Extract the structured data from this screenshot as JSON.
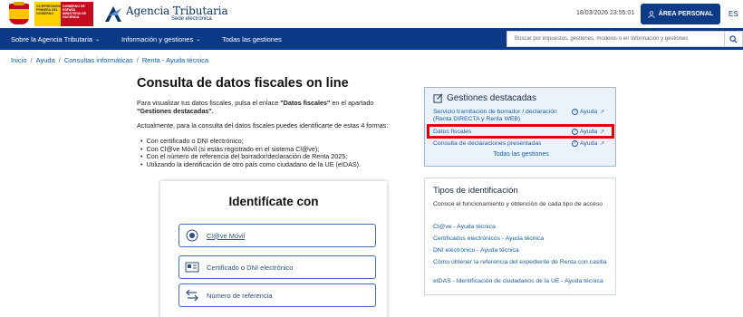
{
  "header": {
    "gov_yellow_text": "VICEPRESIDENCIA PRIMERA DEL GOBIERNO",
    "gov_red_text": "GOBIERNO DE ESPAÑA MINISTERIO DE HACIENDA",
    "agency_title": "Agencia Tributaria",
    "agency_sub": "Sede electrónica",
    "datetime": "18/03/2026 23:55:01",
    "area_button": "ÁREA PERSONAL",
    "lang": "ES"
  },
  "nav": {
    "items": [
      {
        "label": "Sobre la Agencia Tributaria"
      },
      {
        "label": "Información y gestiones"
      },
      {
        "label": "Todas las gestiones"
      }
    ],
    "search_placeholder": "Buscar por impuestos, gestiones, modelos o en Información y gestiones"
  },
  "breadcrumb": [
    "Inicio",
    "Ayuda",
    "Consultas informáticas",
    "Renta - Ayuda técnica"
  ],
  "main": {
    "title": "Consulta de datos fiscales on line",
    "p1_a": "Para visualizar tus datos fiscales, pulsa el enlace ",
    "p1_b": "\"Datos fiscales\"",
    "p1_c": " en el apartado ",
    "p1_d": "\"Gestiones destacadas\".",
    "p2": "Actualmente, para la consulta del datos fiscales puedes identificarte de estas 4 formas:",
    "bullets": [
      "Con certificado o DNI electrónico;",
      "Con Cl@ve Móvil (si estás registrado en el sistema Cl@ve);",
      "Con el número de referencia del borrador/declaración de Renta 2025;",
      "Utilizando la identificación de otro país como ciudadano de la UE (eIDAS)."
    ]
  },
  "identify": {
    "title": "Identifícate con",
    "options": [
      {
        "label": "Cl@ve Móvil"
      },
      {
        "label": "Certificado o DNI electrónico"
      },
      {
        "label": "Número de referencia"
      }
    ]
  },
  "gestiones": {
    "title": "Gestiones destacadas",
    "help_label": "Ayuda",
    "links": [
      {
        "label": "Servicio tramitación de borrador / declaración (Renta DIRECTA y Renta WEB)"
      },
      {
        "label": "Datos fiscales"
      },
      {
        "label": "Consulta de declaraciones presentadas"
      }
    ],
    "all_label": "Todas las gestiones"
  },
  "tipos": {
    "title": "Tipos de identificación",
    "desc": "Conoce el funcionamiento y obtención de cada tipo de acceso",
    "links": [
      {
        "label": "Cl@ve - Ayuda técnica"
      },
      {
        "label": "Certificados electrónicos - Ayuda técnica"
      },
      {
        "label": "DNI electrónico - Ayuda técnica"
      },
      {
        "label": "Cómo obtener la referencia del expediente de Renta con casilla"
      },
      {
        "label": "eIDAS - Identificación de ciudadanos de la UE - Ayuda técnica"
      }
    ]
  },
  "colors": {
    "brand_blue": "#0c3a87",
    "link_blue": "#1a5ea8",
    "highlight_red": "#e00000"
  }
}
